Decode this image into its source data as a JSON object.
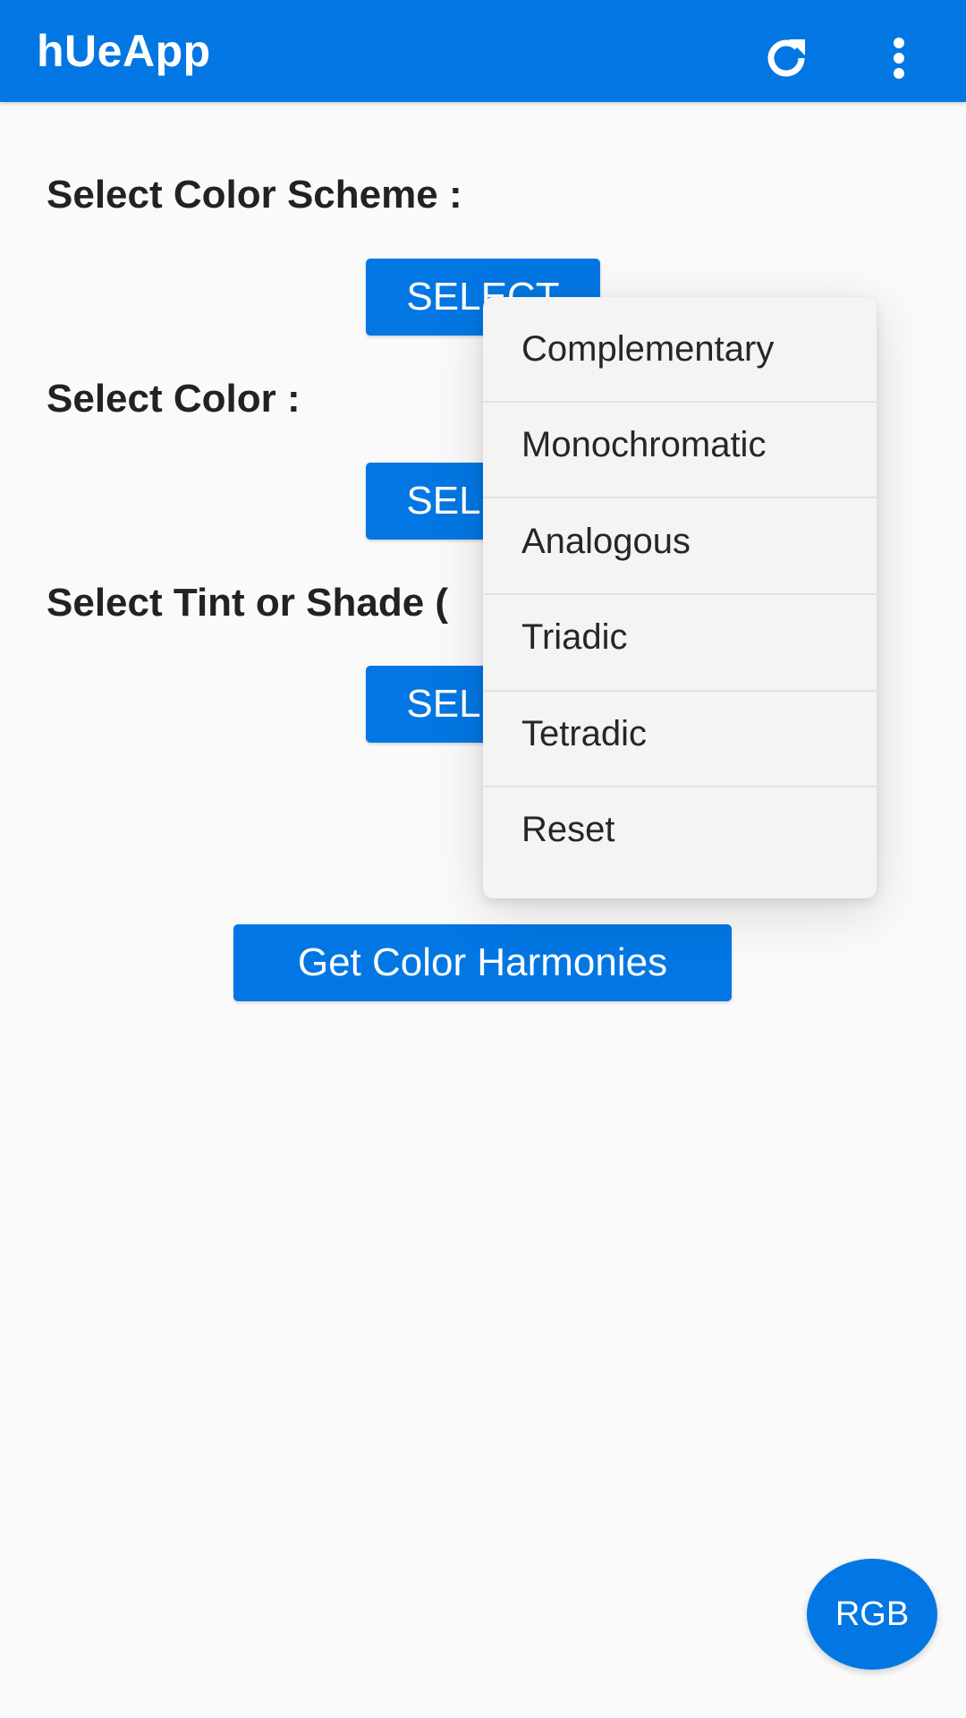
{
  "app_bar": {
    "title": "hUeApp",
    "actions": [
      {
        "icon": "refresh-icon"
      },
      {
        "icon": "more-vert-icon"
      }
    ],
    "color": "#0277e3"
  },
  "sections": [
    {
      "label": "Select Color Scheme :",
      "button_label": "SELECT"
    },
    {
      "label": "Select Color :",
      "button_label": "SELECT"
    },
    {
      "label": "Select Tint or Shade (",
      "button_label": "SELECT"
    }
  ],
  "harmonies_button": {
    "label": "Get Color Harmonies"
  },
  "dropdown": {
    "items": [
      "Complementary",
      "Monochromatic",
      "Analogous",
      "Triadic",
      "Tetradic",
      "Reset"
    ]
  },
  "fab": {
    "label": "RGB"
  },
  "colors": {
    "accent": "#0277e3",
    "background": "#fafafa",
    "text": "#222222",
    "menu_background": "#f4f4f4"
  }
}
